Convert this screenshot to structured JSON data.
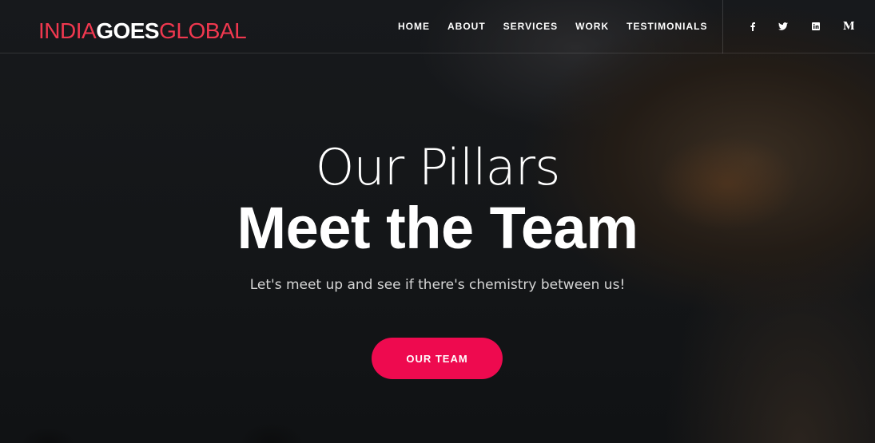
{
  "brand": {
    "part1": "INDIA",
    "part2": "GOES",
    "part3": "GLOBAL",
    "accent_color": "#f0384f"
  },
  "nav": {
    "items": [
      {
        "label": "HOME"
      },
      {
        "label": "ABOUT"
      },
      {
        "label": "SERVICES"
      },
      {
        "label": "WORK"
      },
      {
        "label": "TESTIMONIALS"
      }
    ]
  },
  "social": {
    "icons": [
      "facebook-icon",
      "twitter-icon",
      "linkedin-icon",
      "medium-icon"
    ]
  },
  "hero": {
    "eyebrow": "Our Pillars",
    "title": "Meet the Team",
    "subtitle": "Let's meet up and see if there's chemistry between us!",
    "cta_label": "OUR TEAM",
    "cta_color": "#ee0a4f"
  }
}
